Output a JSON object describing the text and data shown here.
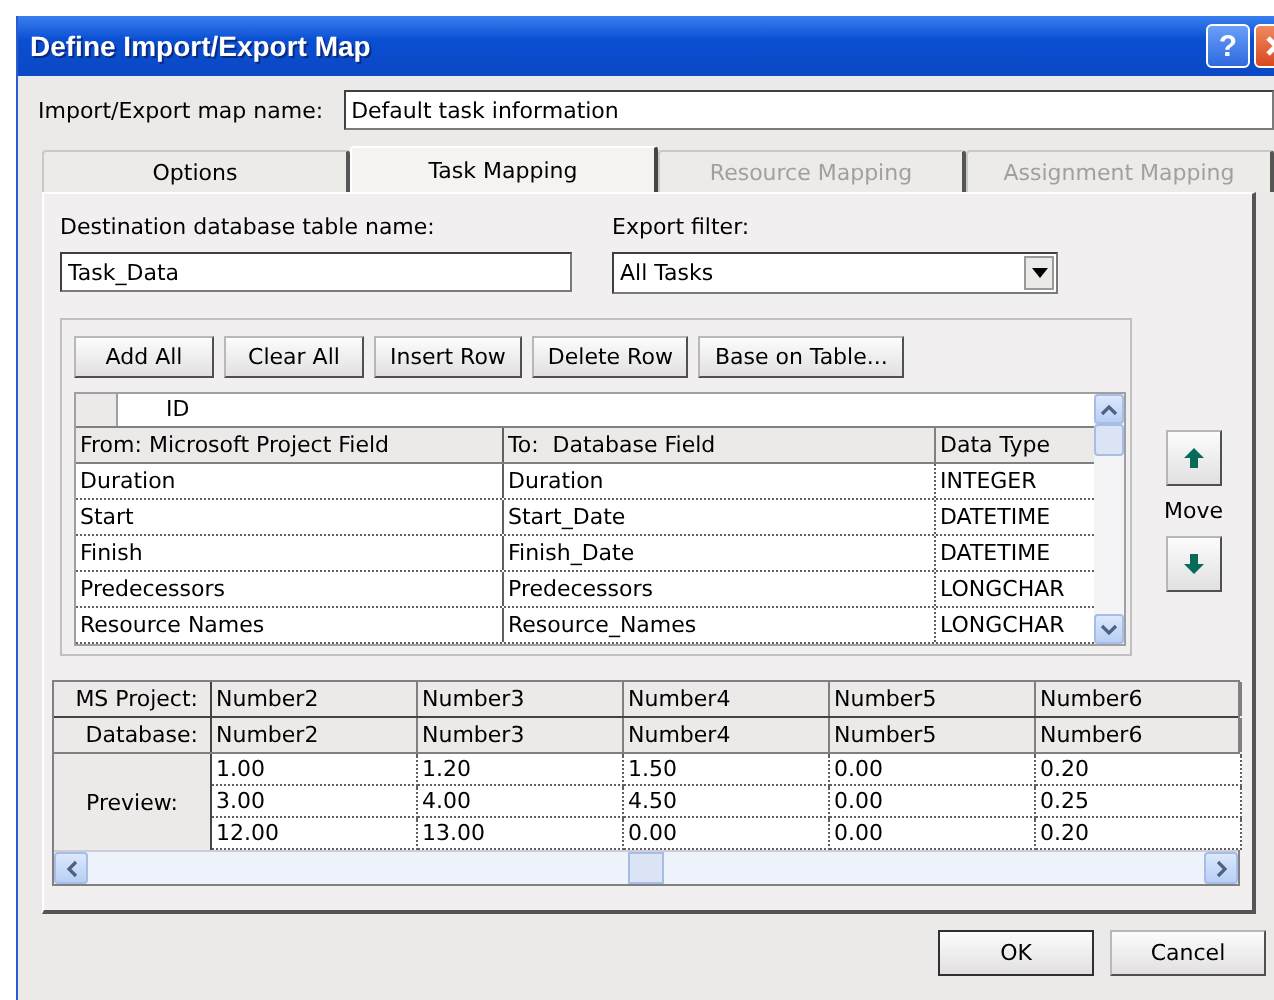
{
  "window": {
    "title": "Define Import/Export Map"
  },
  "title_buttons": [
    {
      "kind": "help",
      "glyph": "?"
    },
    {
      "kind": "close"
    }
  ],
  "map_name": {
    "label": "Import/Export map name:",
    "value": "Default task information"
  },
  "tabs": [
    {
      "label": "Options",
      "selected": false,
      "disabled": false
    },
    {
      "label": "Task Mapping",
      "selected": true,
      "disabled": false
    },
    {
      "label": "Resource Mapping",
      "selected": false,
      "disabled": true
    },
    {
      "label": "Assignment Mapping",
      "selected": false,
      "disabled": true
    }
  ],
  "destination": {
    "label": "Destination database table name:",
    "value": "Task_Data"
  },
  "export_filter": {
    "label": "Export filter:",
    "value": "All Tasks"
  },
  "grid_buttons": [
    "Add All",
    "Clear All",
    "Insert Row",
    "Delete Row",
    "Base on Table..."
  ],
  "field_grid": {
    "current_field": "ID",
    "columns": [
      "From: Microsoft Project Field",
      "To:  Database Field",
      "Data Type"
    ],
    "rows": [
      [
        "Duration",
        "Duration",
        "INTEGER"
      ],
      [
        "Start",
        "Start_Date",
        "DATETIME"
      ],
      [
        "Finish",
        "Finish_Date",
        "DATETIME"
      ],
      [
        "Predecessors",
        "Predecessors",
        "LONGCHAR"
      ],
      [
        "Resource Names",
        "Resource_Names",
        "LONGCHAR"
      ]
    ]
  },
  "move": {
    "label": "Move"
  },
  "preview": {
    "row_labels": [
      "MS Project:",
      "Database:",
      "Preview:"
    ],
    "ms_project": [
      "Number2",
      "Number3",
      "Number4",
      "Number5",
      "Number6"
    ],
    "database": [
      "Number2",
      "Number3",
      "Number4",
      "Number5",
      "Number6"
    ],
    "values": [
      [
        "1.00",
        "1.20",
        "1.50",
        "0.00",
        "0.20"
      ],
      [
        "3.00",
        "4.00",
        "4.50",
        "0.00",
        "0.25"
      ],
      [
        "12.00",
        "13.00",
        "0.00",
        "0.00",
        "0.20"
      ]
    ]
  },
  "buttons": [
    "OK",
    "Cancel"
  ]
}
